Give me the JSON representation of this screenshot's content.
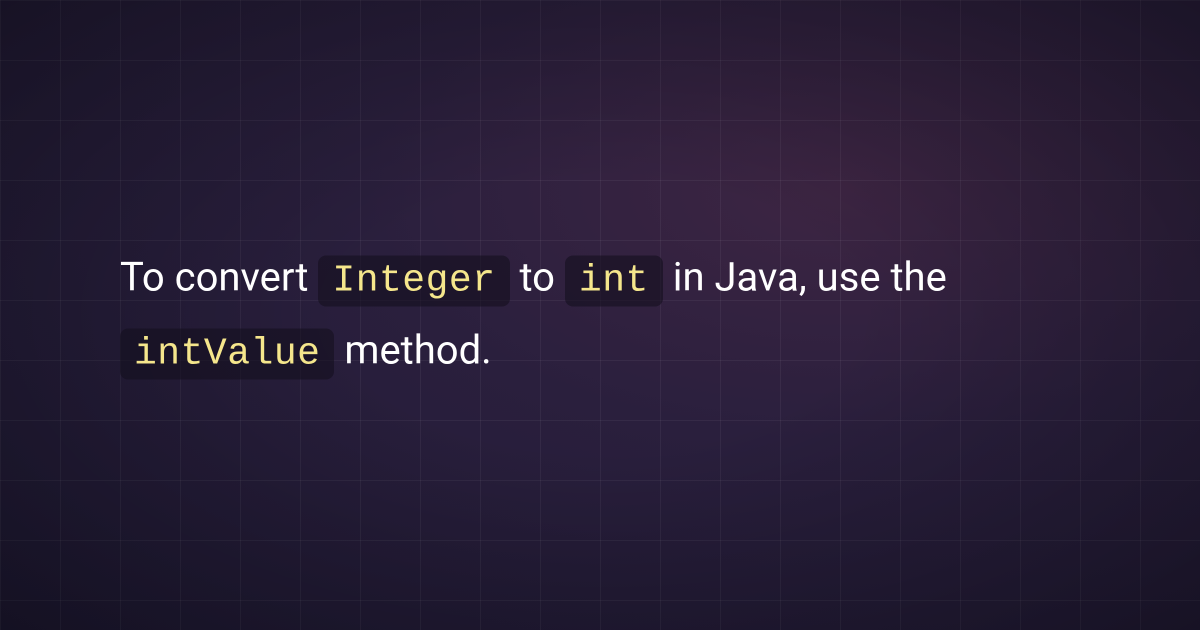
{
  "text": {
    "part1": "To convert ",
    "code1": "Integer",
    "part2": " to ",
    "code2": "int",
    "part3": " in Java, use the ",
    "code3": "intValue",
    "part4": " method."
  }
}
